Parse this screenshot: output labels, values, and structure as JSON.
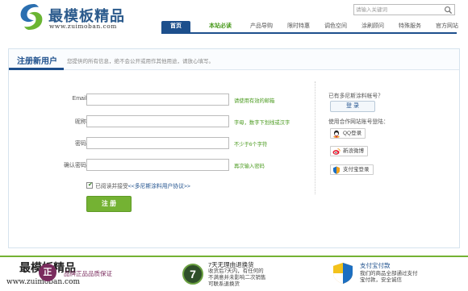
{
  "brand": {
    "name_cn": "最模板精品",
    "site": "www.zuimoban.com"
  },
  "search": {
    "placeholder": "请输入关键词"
  },
  "nav": {
    "items": [
      {
        "label": "首页"
      },
      {
        "label": "本站必读"
      },
      {
        "label": "产品导购"
      },
      {
        "label": "限时特惠"
      },
      {
        "label": "调色空间"
      },
      {
        "label": "涂刷顾问"
      },
      {
        "label": "特殊服务"
      },
      {
        "label": "官方网站"
      }
    ],
    "active_index": 0
  },
  "register": {
    "title": "注册新用户",
    "subtitle": "您提供的所有信息，绝不会公开或用作其他用途，请放心填写。",
    "fields": [
      {
        "label": "Email:",
        "value": "",
        "hint": "请使用有效的邮箱"
      },
      {
        "label": "昵称:",
        "value": "",
        "hint": "字母，数字下划线或汉字"
      },
      {
        "label": "密码:",
        "value": "",
        "hint": "不少于6个字符"
      },
      {
        "label": "确认密码:",
        "value": "",
        "hint": "再次输入密码"
      }
    ],
    "agree_prefix": "已阅读并接受",
    "agree_link": "<<多尼斯涂料用户协议>>",
    "agree_checked": true,
    "submit_label": "注 册"
  },
  "side": {
    "have_account": "已有多尼斯涂料帐号？",
    "login_label": "登 录",
    "partner_prompt": "使用合作网站账号登陆：",
    "oauth": [
      {
        "label": "QQ登录",
        "icon": "qq-icon"
      },
      {
        "label": "新浪微博",
        "icon": "weibo-icon"
      },
      {
        "label": "支付宝登录",
        "icon": "alipay-icon"
      }
    ]
  },
  "footer": {
    "badge_char": "正",
    "item1": "品牌正品品质保证",
    "seven": "7",
    "item2_title": "7天无理由退换货",
    "item2_lines": [
      "收货后7天内，有任何的",
      "不满意并未影响二次销售",
      "可联系退换货"
    ],
    "item3_title": "支付宝付款",
    "item3_lines": [
      "我们的商品全部通过支付",
      "宝付款，安全诚信"
    ]
  },
  "colors": {
    "brand_blue": "#1d4f8c",
    "accent_green": "#74b233",
    "hint_green": "#4a9a1e"
  }
}
